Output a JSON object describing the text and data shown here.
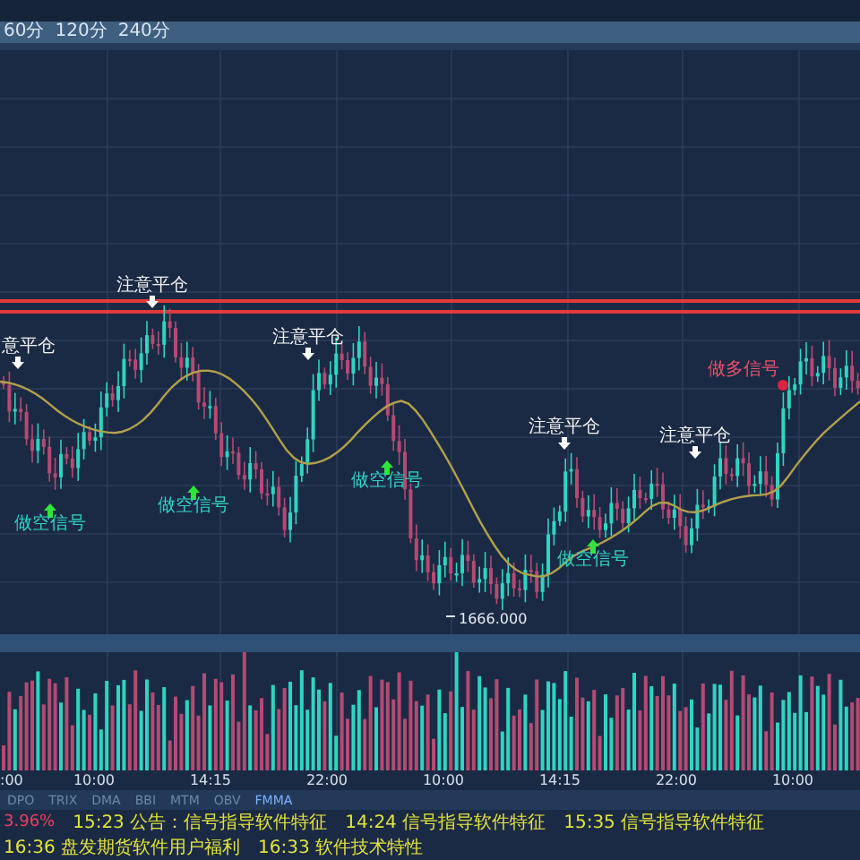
{
  "periods": [
    {
      "label": "60分"
    },
    {
      "label": "120分"
    },
    {
      "label": "240分"
    }
  ],
  "markers": [
    {
      "kind": "close_warning",
      "label": "意平仓"
    },
    {
      "kind": "close_warning",
      "label": "注意平仓"
    },
    {
      "kind": "close_warning",
      "label": "注意平仓"
    },
    {
      "kind": "close_warning",
      "label": "注意平仓"
    },
    {
      "kind": "close_warning",
      "label": "注意平仓"
    },
    {
      "kind": "short_signal",
      "label": "做空信号"
    },
    {
      "kind": "short_signal",
      "label": "做空信号"
    },
    {
      "kind": "short_signal",
      "label": "做空信号"
    },
    {
      "kind": "short_signal",
      "label": "做空信号"
    },
    {
      "kind": "long_signal",
      "label": "做多信号"
    }
  ],
  "low_price": "1666.000",
  "time_axis": [
    ":00",
    "10:00",
    "14:15",
    "22:00",
    "10:00",
    "14:15",
    "22:00",
    "10:00"
  ],
  "indicator_tabs": [
    {
      "label": "DPO",
      "selected": false
    },
    {
      "label": "TRIX",
      "selected": false
    },
    {
      "label": "DMA",
      "selected": false
    },
    {
      "label": "BBI",
      "selected": false
    },
    {
      "label": "MTM",
      "selected": false
    },
    {
      "label": "OBV",
      "selected": false
    },
    {
      "label": "FMMA",
      "selected": true
    }
  ],
  "ticker": {
    "change": "3.96%",
    "news": [
      {
        "time": "15:23",
        "text": "公告：信号指导软件特征"
      },
      {
        "time": "14:24",
        "text": "信号指导软件特征"
      },
      {
        "time": "15:35",
        "text": "信号指导软件特征"
      },
      {
        "time": "16:36",
        "text": "盘发期货软件用户福利"
      },
      {
        "time": "16:33",
        "text": "软件技术特性"
      }
    ]
  }
}
